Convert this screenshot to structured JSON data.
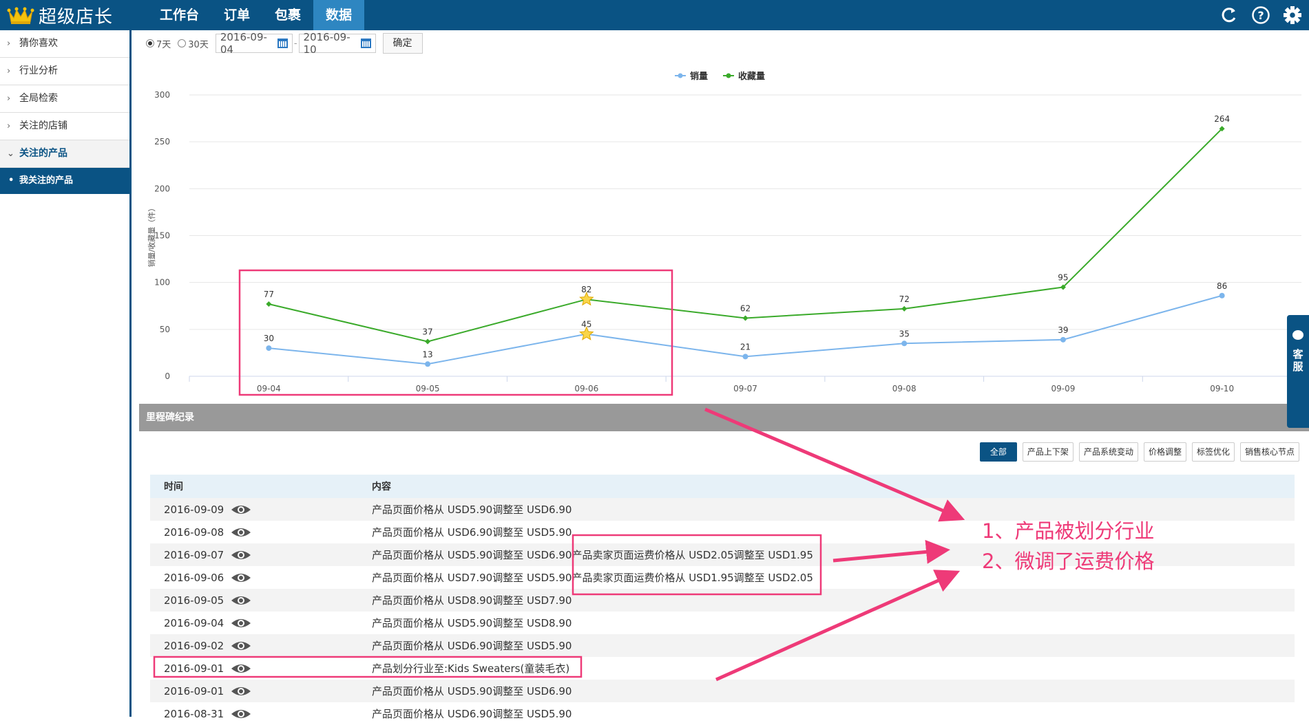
{
  "app": {
    "title": "超级店长"
  },
  "nav": [
    {
      "label": "工作台",
      "active": false
    },
    {
      "label": "订单",
      "active": false
    },
    {
      "label": "包裹",
      "active": false
    },
    {
      "label": "数据",
      "active": true
    }
  ],
  "top_icons": [
    "refresh-icon",
    "help-icon",
    "gear-icon"
  ],
  "sidebar": {
    "items": [
      {
        "label": "猜你喜欢"
      },
      {
        "label": "行业分析"
      },
      {
        "label": "全局检索"
      },
      {
        "label": "关注的店铺"
      },
      {
        "label": "关注的产品",
        "open": true
      }
    ],
    "sub_item": "我关注的产品"
  },
  "filters": {
    "range_options": [
      {
        "label": "7天",
        "selected": true
      },
      {
        "label": "30天",
        "selected": false
      }
    ],
    "start_date": "2016-09-04",
    "end_date": "2016-09-10",
    "separator": "-",
    "confirm_label": "确定"
  },
  "chart_data": {
    "type": "line",
    "x": [
      "09-04",
      "09-05",
      "09-06",
      "09-07",
      "09-08",
      "09-09",
      "09-10"
    ],
    "series": [
      {
        "name": "销量",
        "values": [
          30,
          13,
          45,
          21,
          35,
          39,
          86
        ],
        "color": "#7cb5ec"
      },
      {
        "name": "收藏量",
        "values": [
          77,
          37,
          82,
          62,
          72,
          95,
          264
        ],
        "color": "#3aaa2a"
      }
    ],
    "ylabel": "销量/收藏量（件）",
    "ylim": [
      0,
      300
    ],
    "yticks": [
      0,
      50,
      100,
      150,
      200,
      250,
      300
    ],
    "grid": true,
    "legend": "top-center",
    "star_markers_at": "09-06"
  },
  "milestone": {
    "title": "里程碑纪录",
    "tags": [
      {
        "label": "全部",
        "active": true
      },
      {
        "label": "产品上下架",
        "active": false
      },
      {
        "label": "产品系统变动",
        "active": false
      },
      {
        "label": "价格调整",
        "active": false
      },
      {
        "label": "标签优化",
        "active": false
      },
      {
        "label": "销售核心节点",
        "active": false
      }
    ],
    "columns": {
      "time": "时间",
      "content": "内容"
    },
    "rows": [
      {
        "time": "2016-09-09",
        "content": "产品页面价格从 USD5.90调整至 USD6.90",
        "extra": ""
      },
      {
        "time": "2016-09-08",
        "content": "产品页面价格从 USD6.90调整至 USD5.90",
        "extra": ""
      },
      {
        "time": "2016-09-07",
        "content": "产品页面价格从 USD5.90调整至 USD6.90",
        "extra": "产品卖家页面运费价格从 USD2.05调整至 USD1.95"
      },
      {
        "time": "2016-09-06",
        "content": "产品页面价格从 USD7.90调整至 USD5.90",
        "extra": "产品卖家页面运费价格从 USD1.95调整至 USD2.05"
      },
      {
        "time": "2016-09-05",
        "content": "产品页面价格从 USD8.90调整至 USD7.90",
        "extra": ""
      },
      {
        "time": "2016-09-04",
        "content": "产品页面价格从 USD5.90调整至 USD8.90",
        "extra": ""
      },
      {
        "time": "2016-09-02",
        "content": "产品页面价格从 USD6.90调整至 USD5.90",
        "extra": ""
      },
      {
        "time": "2016-09-01",
        "content": "产品划分行业至:Kids Sweaters(童装毛衣)",
        "extra": ""
      },
      {
        "time": "2016-09-01",
        "content": "产品页面价格从 USD5.90调整至 USD6.90",
        "extra": ""
      },
      {
        "time": "2016-08-31",
        "content": "产品页面价格从 USD6.90调整至 USD5.90",
        "extra": ""
      }
    ]
  },
  "customer_service": {
    "label": "客服"
  },
  "annotations": {
    "note1": "1、产品被划分行业",
    "note2": "2、微调了运费价格",
    "color": "#ee3a78"
  }
}
